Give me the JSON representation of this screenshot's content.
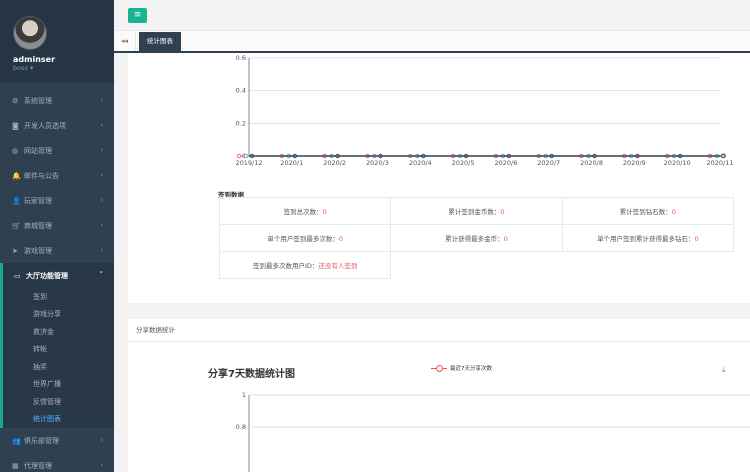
{
  "user": {
    "name": "adminser",
    "role": "boss ▾"
  },
  "sidebar": {
    "items": [
      {
        "label": "系统管理",
        "icon": "gears-icon",
        "glyph": "⚙"
      },
      {
        "label": "开发人员选项",
        "icon": "gamepad-icon",
        "glyph": "◙"
      },
      {
        "label": "网站管理",
        "icon": "globe-icon",
        "glyph": "◍"
      },
      {
        "label": "邮件与公告",
        "icon": "bell-icon",
        "glyph": "🔔"
      },
      {
        "label": "玩家管理",
        "icon": "user-icon",
        "glyph": "👤"
      },
      {
        "label": "商城管理",
        "icon": "cart-icon",
        "glyph": "🛒"
      },
      {
        "label": "游戏管理",
        "icon": "send-icon",
        "glyph": "➤"
      }
    ],
    "active": {
      "label": "大厅功能管理",
      "icon": "monitor-icon",
      "glyph": "▭",
      "arrow": "˅"
    },
    "subitems": [
      "签到",
      "游戏分享",
      "救济金",
      "转帐",
      "抽奖",
      "世界广播",
      "反馈管理",
      "统计图表"
    ],
    "bottom": [
      {
        "label": "俱乐部管理",
        "icon": "users-icon",
        "glyph": "👥"
      },
      {
        "label": "代理管理",
        "icon": "sitemap-icon",
        "glyph": "▦"
      }
    ],
    "arrow": "‹"
  },
  "topbar": {
    "menu_glyph": "≡"
  },
  "tabs": {
    "nav_glyph": "◂◂",
    "active": "统计图表"
  },
  "chart_data": [
    {
      "type": "line",
      "x": [
        "2019/12",
        "2020/1",
        "2020/2",
        "2020/3",
        "2020/4",
        "2020/5",
        "2020/6",
        "2020/7",
        "2020/8",
        "2020/9",
        "2020/10",
        "2020/11"
      ],
      "y_ticks": [
        "0",
        "0.2",
        "0.4",
        "0.6"
      ],
      "ylim": [
        0,
        0.6
      ],
      "series": [
        {
          "values": [
            0,
            0,
            0,
            0,
            0,
            0,
            0,
            0,
            0,
            0,
            0,
            0
          ],
          "color": "#e65555"
        },
        {
          "values": [
            0,
            0,
            0,
            0,
            0,
            0,
            0,
            0,
            0,
            0,
            0,
            0
          ],
          "color": "#5a8dc9"
        },
        {
          "values": [
            0,
            0,
            0,
            0,
            0,
            0,
            0,
            0,
            0,
            0,
            0,
            0
          ],
          "color": "#333333"
        }
      ],
      "end_label": "0"
    },
    {
      "type": "line",
      "title": "分享7天数据统计图",
      "series": [
        {
          "name": "最近7天分享次数",
          "values": [],
          "color": "#e65555"
        }
      ],
      "y_ticks": [
        "0.8",
        "1"
      ],
      "ylim": [
        0,
        1
      ]
    }
  ],
  "stats": {
    "title": "签到数据",
    "rows": [
      [
        {
          "label": "签到总次数：",
          "value": "0"
        },
        {
          "label": "累计签到金币数：",
          "value": "0"
        },
        {
          "label": "累计签到钻石数：",
          "value": "0"
        }
      ],
      [
        {
          "label": "单个用户签到最多次数：",
          "value": "0"
        },
        {
          "label": "累计获得最多金币：",
          "value": "0"
        },
        {
          "label": "单个用户签到累计获得最多钻石：",
          "value": "0"
        }
      ],
      [
        {
          "label": "签到最多次数用户ID：",
          "value": "还没有人签到"
        }
      ]
    ]
  },
  "share": {
    "panel_title": "分享数据统计",
    "download_glyph": "⤓"
  }
}
